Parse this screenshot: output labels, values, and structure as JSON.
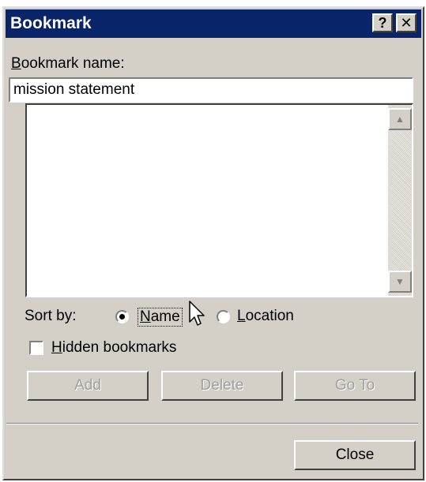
{
  "window": {
    "title": "Bookmark",
    "help_glyph": "?",
    "close_glyph": "✕"
  },
  "bookmark_name": {
    "label_accesskey": "B",
    "label_rest": "ookmark name:",
    "value": "mission statement"
  },
  "listbox": {
    "items": [],
    "scroll_up_glyph": "▲",
    "scroll_down_glyph": "▼"
  },
  "sort": {
    "label": "Sort by:",
    "name_accesskey": "N",
    "name_rest": "ame",
    "location_accesskey": "L",
    "location_rest": "ocation",
    "selected": "Name"
  },
  "hidden": {
    "accesskey": "H",
    "rest": "idden bookmarks",
    "checked": false
  },
  "buttons": {
    "add": "Add",
    "delete": "Delete",
    "goto": "Go To",
    "close": "Close"
  },
  "colors": {
    "titlebar": "#0a246a",
    "dialog": "#d4d0c8",
    "disabled_text": "#a0a0a0"
  },
  "icons": {
    "cursor": "mouse-pointer-icon"
  }
}
